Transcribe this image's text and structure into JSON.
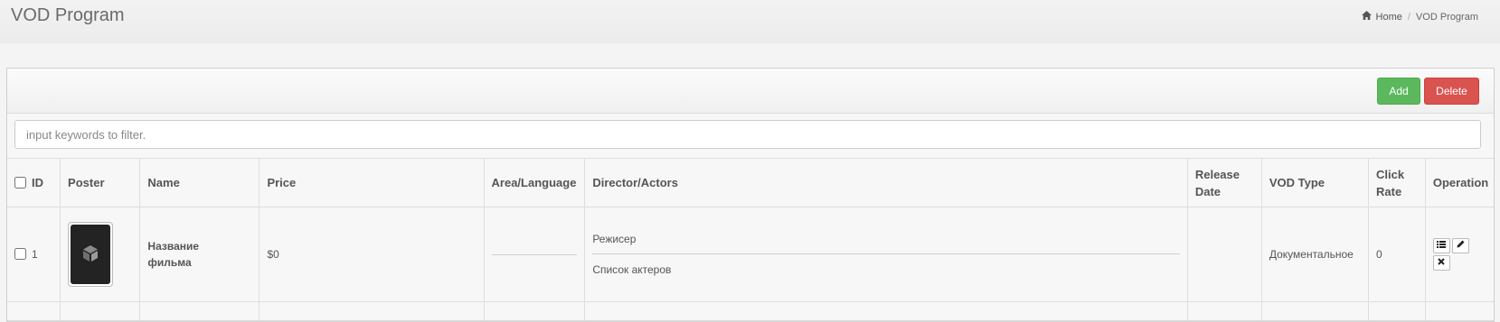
{
  "page": {
    "title": "VOD Program"
  },
  "breadcrumb": {
    "home": "Home",
    "current": "VOD Program",
    "separator": "/"
  },
  "toolbar": {
    "add_label": "Add",
    "delete_label": "Delete"
  },
  "filter": {
    "placeholder": "input keywords to filter.",
    "value": ""
  },
  "table": {
    "headers": {
      "id": "ID",
      "poster": "Poster",
      "name": "Name",
      "price": "Price",
      "area": "Area/Language",
      "director": "Director/Actors",
      "release_line1": "Release",
      "release_line2": "Date",
      "vod_type": "VOD Type",
      "click_line1": "Click",
      "click_line2": "Rate",
      "operation": "Operation"
    },
    "rows": [
      {
        "id": "1",
        "name_line1": "Название",
        "name_line2": "фильма",
        "price": "$0",
        "area": "",
        "director": "Режисер",
        "actors": "Список актеров",
        "release_date": "",
        "vod_type": "Документальное",
        "click_rate": "0"
      }
    ]
  },
  "icons": {
    "home": "home-icon",
    "poster": "cube-logo-icon",
    "list": "list-icon",
    "edit": "pencil-icon",
    "remove": "close-icon"
  },
  "colors": {
    "add": "#5cb85c",
    "delete": "#d9534f"
  }
}
